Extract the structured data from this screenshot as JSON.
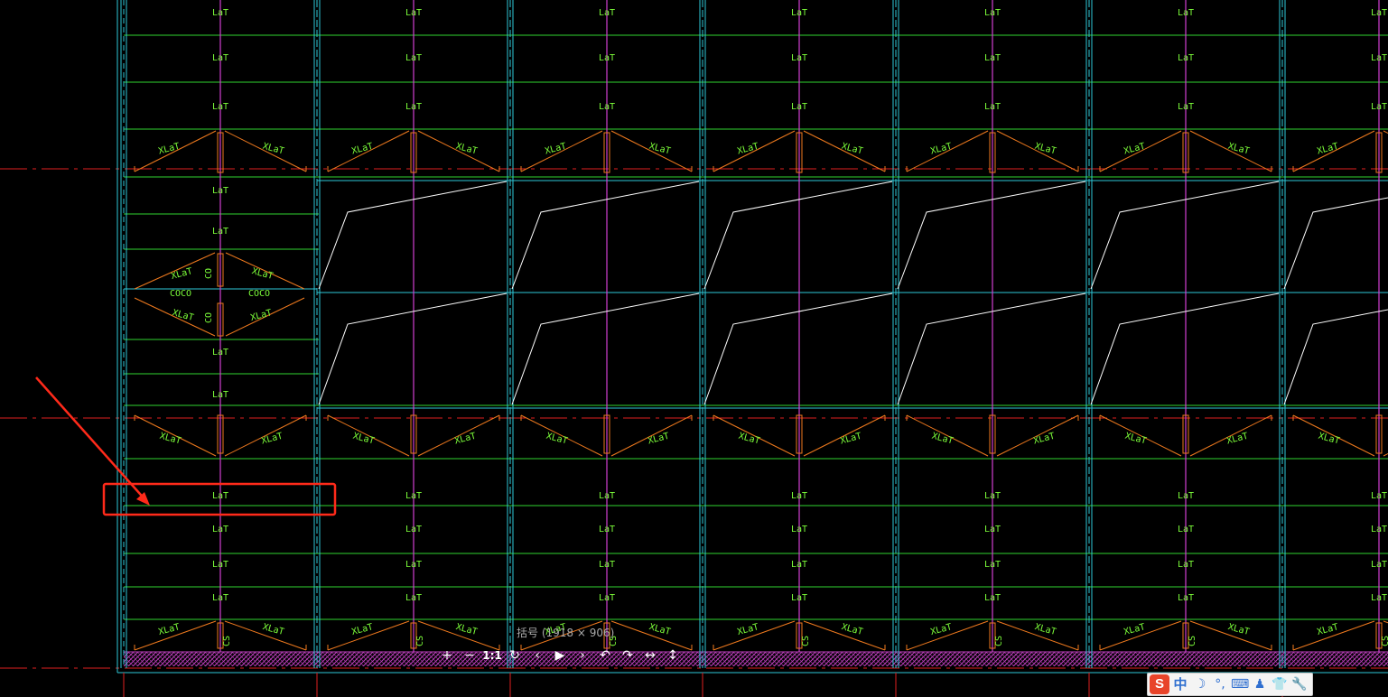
{
  "drawing": {
    "labels": {
      "lat": "LaT",
      "xlat": "XLaT",
      "co": "CO",
      "cs": "CS",
      "coco": "COCO"
    },
    "colors": {
      "background": "#000000",
      "grid_cyan": "#2ec8d8",
      "green_line": "#2fd42f",
      "magenta_line": "#d23fd2",
      "orange_brace": "#f07a1e",
      "white_line": "#ffffff",
      "red_axis": "#e02020",
      "label_green": "#7dff3a",
      "hatch_magenta": "#c040c0",
      "annotation_red": "#ff2a1a"
    }
  },
  "annotation": {
    "arrow_icon": "red-arrow",
    "highlight": "red-rectangle"
  },
  "viewer": {
    "caption": "括号 (1918 × 906)",
    "toolbar": [
      {
        "name": "zoom-in-button",
        "label": "+"
      },
      {
        "name": "zoom-out-button",
        "label": "−"
      },
      {
        "name": "actual-size-button",
        "label": "1:1"
      },
      {
        "name": "reset-button",
        "label": "↻"
      },
      {
        "name": "previous-button",
        "label": "‹"
      },
      {
        "name": "play-button",
        "label": "▶"
      },
      {
        "name": "next-button",
        "label": "›"
      },
      {
        "name": "rotate-left-button",
        "label": "↶"
      },
      {
        "name": "rotate-right-button",
        "label": "↷"
      },
      {
        "name": "flip-horizontal-button",
        "label": "↔"
      },
      {
        "name": "flip-vertical-button",
        "label": "↕"
      }
    ]
  },
  "ime": {
    "logo": "S",
    "items": [
      {
        "name": "chinese-mode-toggle",
        "label": "中"
      },
      {
        "name": "half-width-icon",
        "label": "☽"
      },
      {
        "name": "punctuation-icon",
        "label": "°,"
      },
      {
        "name": "soft-keyboard-icon",
        "label": "⌨"
      },
      {
        "name": "user-icon",
        "label": "♟"
      },
      {
        "name": "skin-icon",
        "label": "👕"
      },
      {
        "name": "settings-wrench-icon",
        "label": "🔧"
      }
    ]
  }
}
